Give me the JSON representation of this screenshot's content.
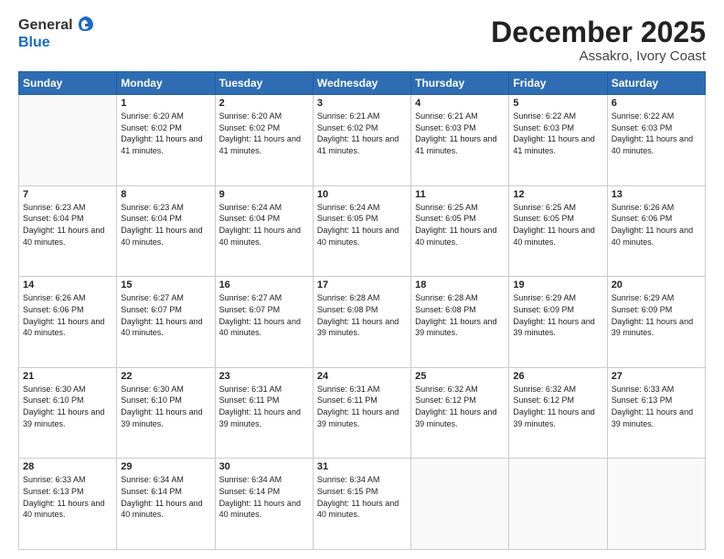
{
  "header": {
    "logo_general": "General",
    "logo_blue": "Blue",
    "month_title": "December 2025",
    "location": "Assakro, Ivory Coast"
  },
  "weekdays": [
    "Sunday",
    "Monday",
    "Tuesday",
    "Wednesday",
    "Thursday",
    "Friday",
    "Saturday"
  ],
  "weeks": [
    [
      {
        "day": "",
        "sunrise": "",
        "sunset": "",
        "daylight": ""
      },
      {
        "day": "1",
        "sunrise": "6:20 AM",
        "sunset": "6:02 PM",
        "daylight": "11 hours and 41 minutes."
      },
      {
        "day": "2",
        "sunrise": "6:20 AM",
        "sunset": "6:02 PM",
        "daylight": "11 hours and 41 minutes."
      },
      {
        "day": "3",
        "sunrise": "6:21 AM",
        "sunset": "6:02 PM",
        "daylight": "11 hours and 41 minutes."
      },
      {
        "day": "4",
        "sunrise": "6:21 AM",
        "sunset": "6:03 PM",
        "daylight": "11 hours and 41 minutes."
      },
      {
        "day": "5",
        "sunrise": "6:22 AM",
        "sunset": "6:03 PM",
        "daylight": "11 hours and 41 minutes."
      },
      {
        "day": "6",
        "sunrise": "6:22 AM",
        "sunset": "6:03 PM",
        "daylight": "11 hours and 40 minutes."
      }
    ],
    [
      {
        "day": "7",
        "sunrise": "6:23 AM",
        "sunset": "6:04 PM",
        "daylight": "11 hours and 40 minutes."
      },
      {
        "day": "8",
        "sunrise": "6:23 AM",
        "sunset": "6:04 PM",
        "daylight": "11 hours and 40 minutes."
      },
      {
        "day": "9",
        "sunrise": "6:24 AM",
        "sunset": "6:04 PM",
        "daylight": "11 hours and 40 minutes."
      },
      {
        "day": "10",
        "sunrise": "6:24 AM",
        "sunset": "6:05 PM",
        "daylight": "11 hours and 40 minutes."
      },
      {
        "day": "11",
        "sunrise": "6:25 AM",
        "sunset": "6:05 PM",
        "daylight": "11 hours and 40 minutes."
      },
      {
        "day": "12",
        "sunrise": "6:25 AM",
        "sunset": "6:05 PM",
        "daylight": "11 hours and 40 minutes."
      },
      {
        "day": "13",
        "sunrise": "6:26 AM",
        "sunset": "6:06 PM",
        "daylight": "11 hours and 40 minutes."
      }
    ],
    [
      {
        "day": "14",
        "sunrise": "6:26 AM",
        "sunset": "6:06 PM",
        "daylight": "11 hours and 40 minutes."
      },
      {
        "day": "15",
        "sunrise": "6:27 AM",
        "sunset": "6:07 PM",
        "daylight": "11 hours and 40 minutes."
      },
      {
        "day": "16",
        "sunrise": "6:27 AM",
        "sunset": "6:07 PM",
        "daylight": "11 hours and 40 minutes."
      },
      {
        "day": "17",
        "sunrise": "6:28 AM",
        "sunset": "6:08 PM",
        "daylight": "11 hours and 39 minutes."
      },
      {
        "day": "18",
        "sunrise": "6:28 AM",
        "sunset": "6:08 PM",
        "daylight": "11 hours and 39 minutes."
      },
      {
        "day": "19",
        "sunrise": "6:29 AM",
        "sunset": "6:09 PM",
        "daylight": "11 hours and 39 minutes."
      },
      {
        "day": "20",
        "sunrise": "6:29 AM",
        "sunset": "6:09 PM",
        "daylight": "11 hours and 39 minutes."
      }
    ],
    [
      {
        "day": "21",
        "sunrise": "6:30 AM",
        "sunset": "6:10 PM",
        "daylight": "11 hours and 39 minutes."
      },
      {
        "day": "22",
        "sunrise": "6:30 AM",
        "sunset": "6:10 PM",
        "daylight": "11 hours and 39 minutes."
      },
      {
        "day": "23",
        "sunrise": "6:31 AM",
        "sunset": "6:11 PM",
        "daylight": "11 hours and 39 minutes."
      },
      {
        "day": "24",
        "sunrise": "6:31 AM",
        "sunset": "6:11 PM",
        "daylight": "11 hours and 39 minutes."
      },
      {
        "day": "25",
        "sunrise": "6:32 AM",
        "sunset": "6:12 PM",
        "daylight": "11 hours and 39 minutes."
      },
      {
        "day": "26",
        "sunrise": "6:32 AM",
        "sunset": "6:12 PM",
        "daylight": "11 hours and 39 minutes."
      },
      {
        "day": "27",
        "sunrise": "6:33 AM",
        "sunset": "6:13 PM",
        "daylight": "11 hours and 39 minutes."
      }
    ],
    [
      {
        "day": "28",
        "sunrise": "6:33 AM",
        "sunset": "6:13 PM",
        "daylight": "11 hours and 40 minutes."
      },
      {
        "day": "29",
        "sunrise": "6:34 AM",
        "sunset": "6:14 PM",
        "daylight": "11 hours and 40 minutes."
      },
      {
        "day": "30",
        "sunrise": "6:34 AM",
        "sunset": "6:14 PM",
        "daylight": "11 hours and 40 minutes."
      },
      {
        "day": "31",
        "sunrise": "6:34 AM",
        "sunset": "6:15 PM",
        "daylight": "11 hours and 40 minutes."
      },
      {
        "day": "",
        "sunrise": "",
        "sunset": "",
        "daylight": ""
      },
      {
        "day": "",
        "sunrise": "",
        "sunset": "",
        "daylight": ""
      },
      {
        "day": "",
        "sunrise": "",
        "sunset": "",
        "daylight": ""
      }
    ]
  ]
}
